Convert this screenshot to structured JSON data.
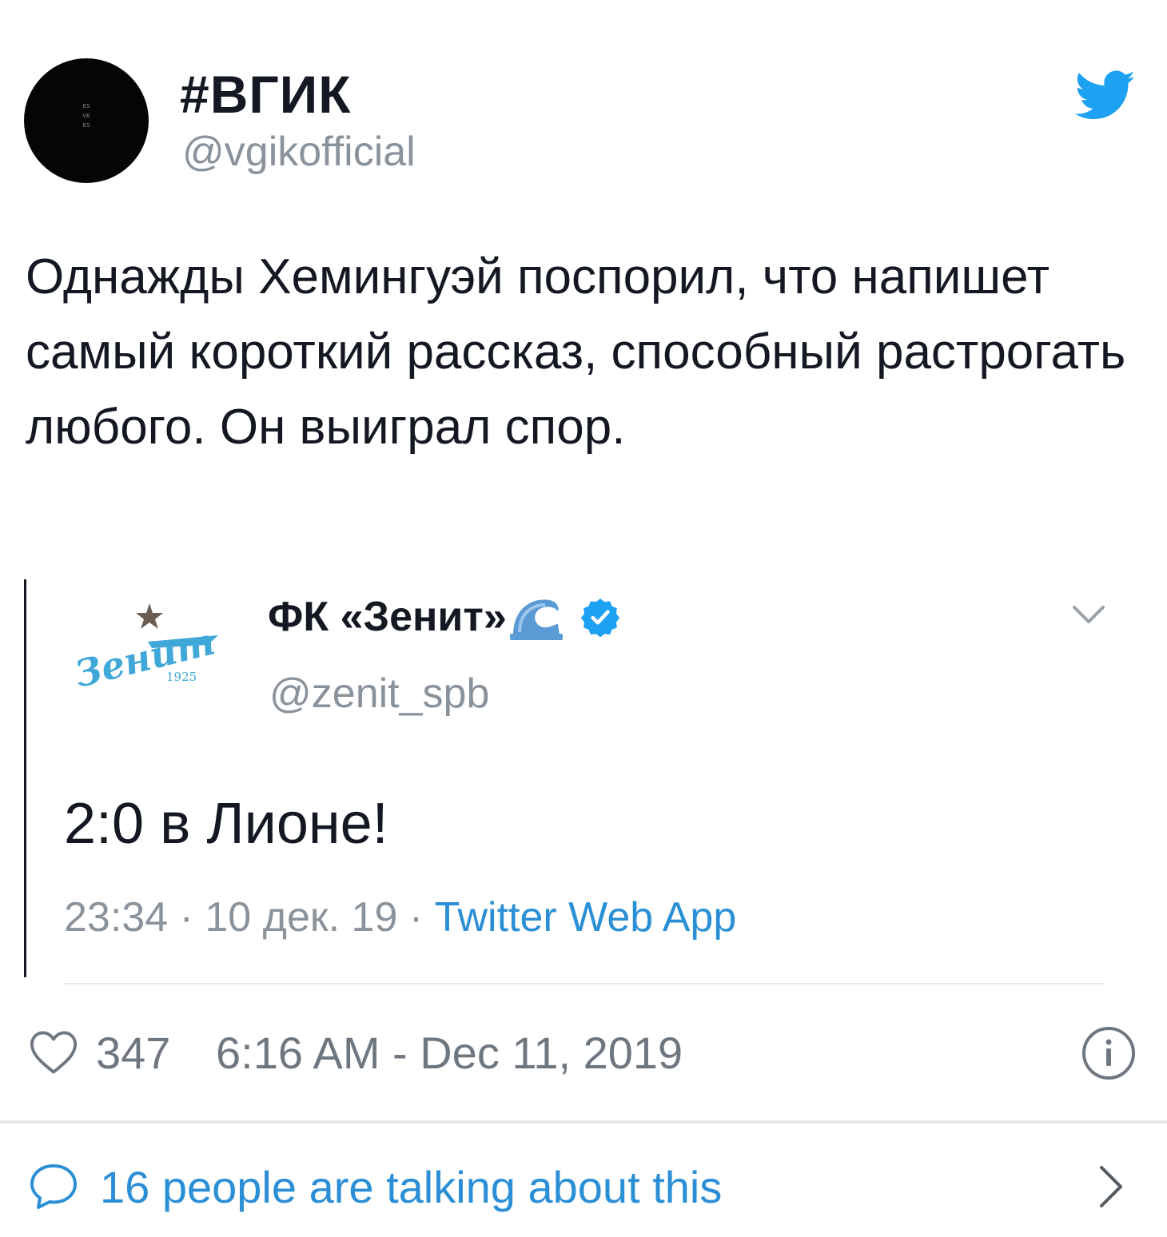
{
  "author": {
    "name": "#ВГИК",
    "handle": "@vgikofficial",
    "avatar_text": [
      "ES",
      "VK",
      "ES"
    ]
  },
  "tweet": {
    "text": "Однажды Хемингуэй поспорил, что напишет самый короткий рассказ, способный растрогать любого. Он выиграл спор."
  },
  "quoted": {
    "name": "ФК «Зенит»",
    "handle": "@zenit_spb",
    "logo_text": "Зенит",
    "logo_year": "1925",
    "text": "2:0 в Лионе!",
    "time": "23:34 · 10 дек. 19 · ",
    "source": "Twitter Web App"
  },
  "stats": {
    "likes": "347",
    "timestamp": "6:16 AM - Dec 11, 2019"
  },
  "talking": {
    "label": "16 people are talking about this"
  },
  "colors": {
    "twitter_blue": "#1da1f2",
    "link_blue": "#2b8fd6",
    "muted_gray": "#8a939b"
  },
  "icons": [
    "twitter-bird-icon",
    "verified-badge-icon",
    "wave-emoji-icon",
    "chevron-down-icon",
    "heart-icon",
    "info-icon",
    "speech-bubble-icon",
    "chevron-right-icon"
  ]
}
